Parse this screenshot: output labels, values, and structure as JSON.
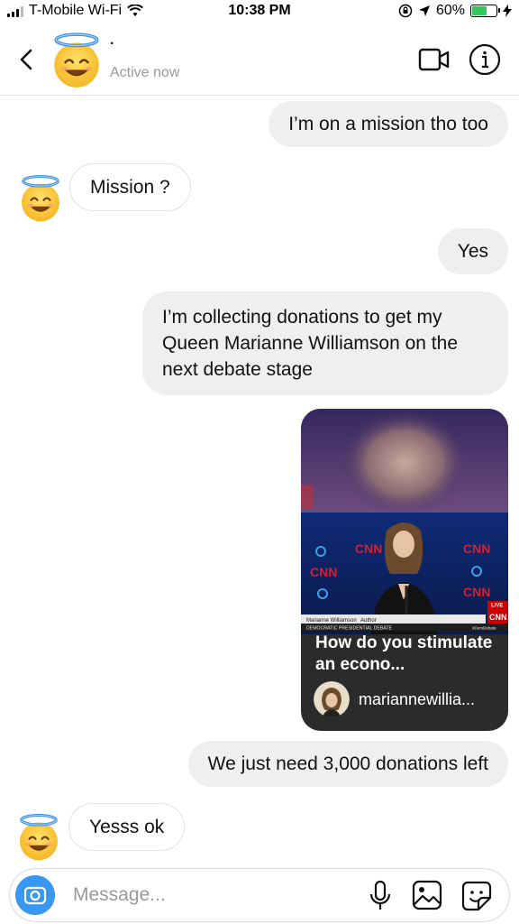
{
  "status_bar": {
    "carrier": "T-Mobile Wi-Fi",
    "time": "10:38 PM",
    "battery": "60%",
    "battery_level": 0.6
  },
  "header": {
    "name": "·",
    "status": "Active now",
    "avatar_icon": "smiling-face-with-halo-icon"
  },
  "messages": [
    {
      "direction": "out",
      "text": "I’m on a mission tho too"
    },
    {
      "direction": "in",
      "text": "Mission ?"
    },
    {
      "direction": "out",
      "text": "Yes"
    },
    {
      "direction": "out",
      "text": "I’m collecting donations to get my Queen Marianne Williamson on the next debate stage"
    },
    {
      "direction": "out",
      "type": "shared_post",
      "caption": "How do you stimulate an econo...",
      "author": "mariannewillia...",
      "overlay": {
        "network": "CNN",
        "lower_third_name": "Marianne Williamson",
        "lower_third_role": "Author",
        "lower_third_event": "DEMOCRATIC PRESIDENTIAL DEBATE",
        "live_tag": "LIVE",
        "hashtag": "#DemDebate"
      }
    },
    {
      "direction": "out",
      "text": "We just need 3,000 donations left"
    },
    {
      "direction": "in",
      "text": "Yesss ok"
    }
  ],
  "composer": {
    "placeholder": "Message..."
  },
  "colors": {
    "accent": "#3897f0",
    "bubble_out": "#efefef",
    "secondary_text": "#9a9a9a",
    "battery_green": "#34c759",
    "cnn_red": "#cc0000"
  }
}
